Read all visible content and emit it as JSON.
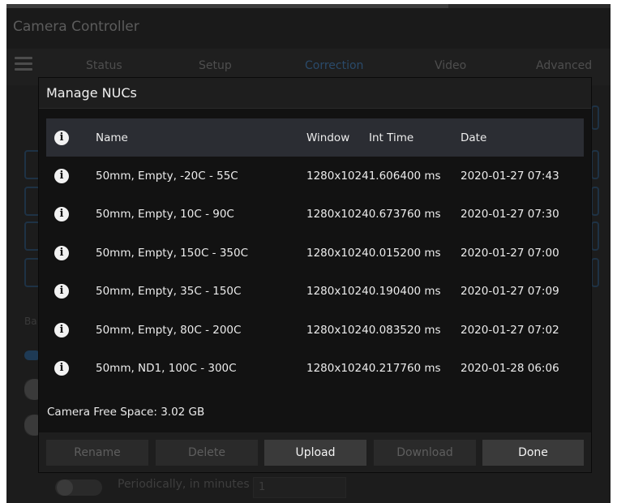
{
  "app": {
    "title": "Camera Controller",
    "tabs": [
      "Status",
      "Setup",
      "Correction",
      "Video",
      "Advanced"
    ],
    "active_tab": "Correction",
    "background": {
      "ba_label": "Ba",
      "periodic_label": "Periodically, in minutes",
      "periodic_value": "1"
    }
  },
  "dialog": {
    "title": "Manage NUCs",
    "columns": {
      "info": "info-icon",
      "name": "Name",
      "window": "Window",
      "int_time": "Int Time",
      "date": "Date"
    },
    "rows": [
      {
        "name": "50mm, Empty, -20C - 55C",
        "window": "1280x1024",
        "int_time": "1.606400 ms",
        "date": "2020-01-27 07:43"
      },
      {
        "name": "50mm, Empty, 10C - 90C",
        "window": "1280x1024",
        "int_time": "0.673760 ms",
        "date": "2020-01-27 07:30"
      },
      {
        "name": "50mm, Empty, 150C - 350C",
        "window": "1280x1024",
        "int_time": "0.015200 ms",
        "date": "2020-01-27 07:00"
      },
      {
        "name": "50mm, Empty, 35C - 150C",
        "window": "1280x1024",
        "int_time": "0.190400 ms",
        "date": "2020-01-27 07:09"
      },
      {
        "name": "50mm, Empty, 80C - 200C",
        "window": "1280x1024",
        "int_time": "0.083520 ms",
        "date": "2020-01-27 07:02"
      },
      {
        "name": "50mm, ND1, 100C - 300C",
        "window": "1280x1024",
        "int_time": "0.217760 ms",
        "date": "2020-01-28 06:06"
      }
    ],
    "free_space": "Camera Free Space: 3.02 GB",
    "buttons": {
      "rename": "Rename",
      "delete": "Delete",
      "upload": "Upload",
      "download": "Download",
      "done": "Done"
    }
  },
  "colors": {
    "dialog_bg": "#121212",
    "header_row_bg": "#2b2d33",
    "button_enabled": "#3a3a3a",
    "button_disabled": "#2a2a2a",
    "active_tab": "#2a4a6a"
  }
}
